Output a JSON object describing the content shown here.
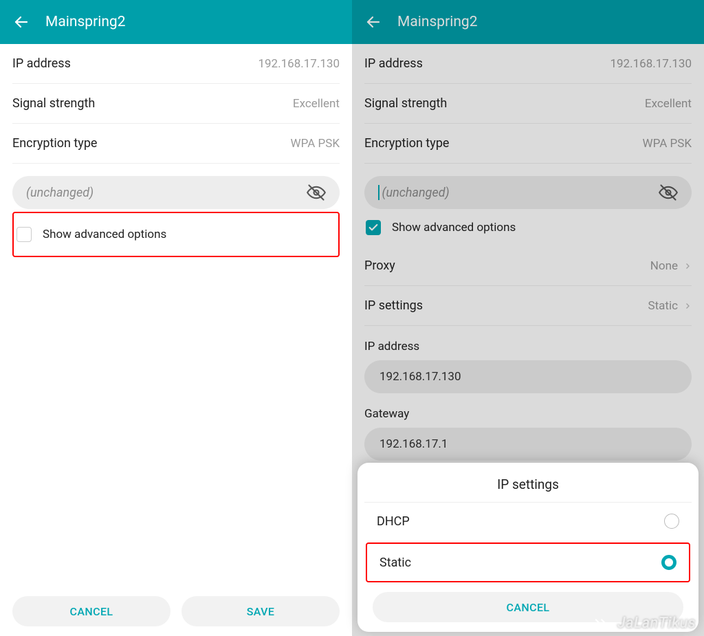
{
  "header": {
    "title": "Mainspring2"
  },
  "info": {
    "ip_label": "IP address",
    "ip_value": "192.168.17.130",
    "signal_label": "Signal strength",
    "signal_value": "Excellent",
    "enc_label": "Encryption type",
    "enc_value": "WPA PSK"
  },
  "password": {
    "placeholder": "(unchanged)"
  },
  "advanced": {
    "label": "Show advanced options"
  },
  "expanded": {
    "proxy_label": "Proxy",
    "proxy_value": "None",
    "ipset_label": "IP settings",
    "ipset_value": "Static",
    "ipaddr_label": "IP address",
    "ipaddr_value": "192.168.17.130",
    "gateway_label": "Gateway",
    "gateway_value": "192.168.17.1"
  },
  "buttons": {
    "cancel": "CANCEL",
    "save": "SAVE"
  },
  "sheet": {
    "title": "IP settings",
    "option_dhcp": "DHCP",
    "option_static": "Static",
    "cancel": "CANCEL"
  },
  "watermark": {
    "text": "JaLanTikus"
  }
}
